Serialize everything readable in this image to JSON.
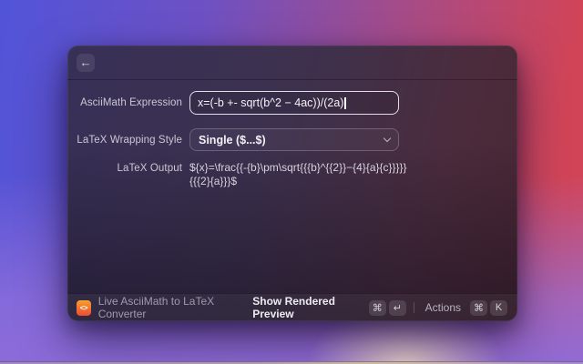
{
  "header": {
    "back_icon": "←"
  },
  "form": {
    "expression": {
      "label": "AsciiMath Expression",
      "value": "x=(-b +- sqrt(b^2 − 4ac))/(2a)"
    },
    "wrapping": {
      "label": "LaTeX Wrapping Style",
      "value": "Single ($...$)"
    },
    "output": {
      "label": "LaTeX Output",
      "line1": "${x}=\\frac{{-{b}\\pm\\sqrt{{{b}^{{2}}−{4}{a}{c}}}}}",
      "line2": "{{{2}{a}}}$"
    }
  },
  "footer": {
    "icon_glyph": "<>",
    "title": "Live AsciiMath to LaTeX Converter",
    "primary_action": "Show Rendered Preview",
    "actions_label": "Actions",
    "shortcuts": [
      "⌘",
      "↵",
      "⌘",
      "K"
    ]
  },
  "colors": {
    "extension_icon_top": "#f7a12d",
    "extension_icon_bottom": "#ec4a32",
    "focused_input_border": "#f3f1f8",
    "background_blue": "#5154d9",
    "background_red": "#d14457",
    "background_purple": "#8e6cd9"
  }
}
